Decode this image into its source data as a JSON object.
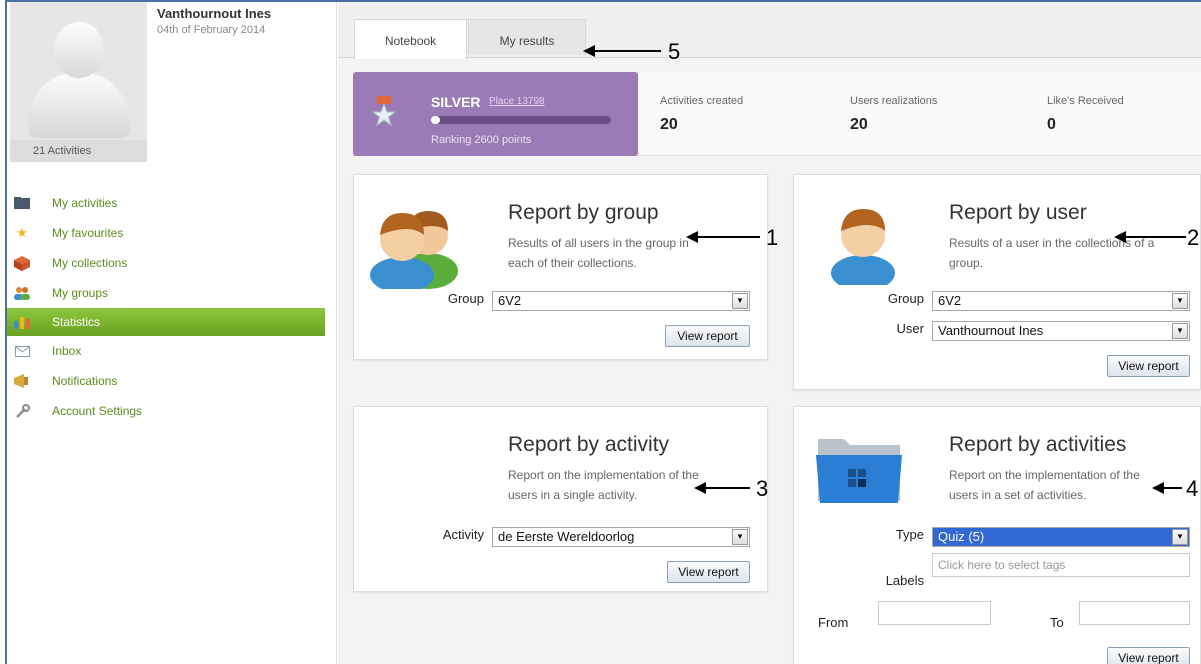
{
  "user": {
    "name": "Vanthournout Ines",
    "date": "04th of February 2014",
    "activities_count": "21 Activities"
  },
  "sidebar": {
    "items": [
      {
        "label": "My activities",
        "icon": "folder-icon"
      },
      {
        "label": "My favourites",
        "icon": "star-icon"
      },
      {
        "label": "My collections",
        "icon": "box-icon"
      },
      {
        "label": "My groups",
        "icon": "users-icon"
      },
      {
        "label": "Statistics",
        "icon": "bar-chart-icon",
        "active": true
      },
      {
        "label": "Inbox",
        "icon": "envelope-icon"
      },
      {
        "label": "Notifications",
        "icon": "megaphone-icon"
      },
      {
        "label": "Account Settings",
        "icon": "wrench-icon"
      }
    ]
  },
  "tabs": [
    {
      "label": "Notebook",
      "active": true
    },
    {
      "label": "My results",
      "active": false
    }
  ],
  "ranking": {
    "level": "SILVER",
    "place": "Place 13798",
    "points": "Ranking 2600 points",
    "progress": 0.05
  },
  "stats": [
    {
      "label": "Activities created",
      "value": "20"
    },
    {
      "label": "Users realizations",
      "value": "20"
    },
    {
      "label": "Like's Received",
      "value": "0"
    }
  ],
  "report_group": {
    "title": "Report by group",
    "desc_line1": "Results of all users in the group in",
    "desc_line2": "each of their collections.",
    "group_label": "Group",
    "group_value": "6V2",
    "button": "View report"
  },
  "report_user": {
    "title": "Report by user",
    "desc_line1": "Results of a user in the collections of a",
    "desc_line2": "group.",
    "group_label": "Group",
    "group_value": "6V2",
    "user_label": "User",
    "user_value": "Vanthournout Ines",
    "button": "View report"
  },
  "report_activity": {
    "title": "Report by activity",
    "desc_line1": "Report on the implementation of the",
    "desc_line2": "users in a single activity.",
    "activity_label": "Activity",
    "activity_value": "de Eerste Wereldoorlog",
    "button": "View report"
  },
  "report_activities": {
    "title": "Report by activities",
    "desc_line1": "Report on the implementation of the",
    "desc_line2": "users in a set of activities.",
    "type_label": "Type",
    "type_value": "Quiz (5)",
    "labels_label": "Labels",
    "labels_placeholder": "Click here to select tags",
    "from_label": "From",
    "to_label": "To",
    "button": "View report"
  },
  "annotations": [
    "1",
    "2",
    "3",
    "4",
    "5"
  ],
  "colors": {
    "accent_green": "#6aa221",
    "rank_purple": "#9b7bb5",
    "link_green": "#5a8c1e"
  }
}
